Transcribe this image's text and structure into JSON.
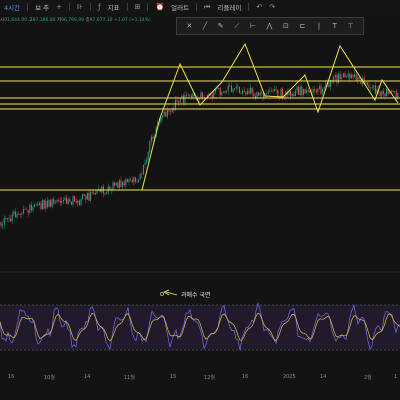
{
  "toolbar": {
    "timeframe": "4시간",
    "compare_label": "보 추",
    "indicators_label": "지표",
    "alerts_label": "얼러트",
    "replay_label": "리플레이",
    "undo_icon": "undo-icon",
    "redo_icon": "redo-icon"
  },
  "ohlc": {
    "o_label": "시",
    "o_value": "91,644.00",
    "h_label": "고",
    "h_value": "97,186.00",
    "l_label": "저",
    "l_value": "96,799.99",
    "c_label": "종",
    "c_value": "97,077.10",
    "change": "+1.07 (+1.14%)"
  },
  "drawing_tools": [
    "✕",
    "╱",
    "✎",
    "⟋",
    "⊢",
    "⋀",
    "⊡",
    "⊏",
    "❘",
    "T",
    "⊤"
  ],
  "annotation": "과매수 국면",
  "x_axis_labels": [
    "16",
    "10월",
    "14",
    "11월",
    "15",
    "12월",
    "16",
    "2025",
    "14",
    "2월",
    "1"
  ],
  "colors": {
    "background": "#131313",
    "candle_up": "#26a69a",
    "candle_down": "#ef5350",
    "annotation_line": "#f3e34a",
    "indicator": "#7e6cf0",
    "indicator_signal": "#e8c14a"
  }
}
